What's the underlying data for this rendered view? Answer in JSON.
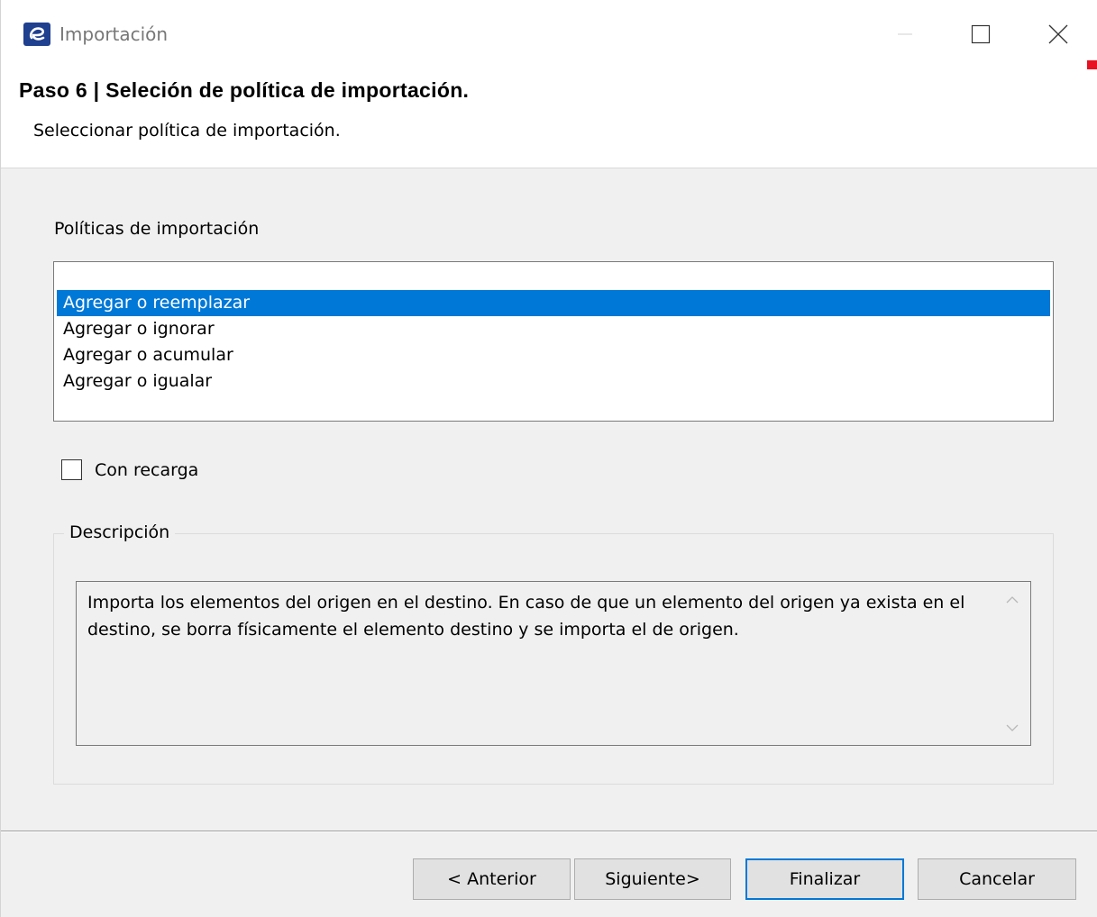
{
  "window": {
    "title": "Importación",
    "icon": "app-logo-icon"
  },
  "header": {
    "step_title": "Paso 6 | Seleción de política de importación.",
    "subtitle": "Seleccionar política de importación."
  },
  "policies": {
    "label": "Políticas de importación",
    "items": [
      {
        "label": "Agregar o reemplazar",
        "selected": true
      },
      {
        "label": "Agregar o ignorar",
        "selected": false
      },
      {
        "label": "Agregar o acumular",
        "selected": false
      },
      {
        "label": "Agregar o igualar",
        "selected": false
      }
    ]
  },
  "reload": {
    "label": "Con recarga",
    "checked": false
  },
  "description": {
    "group_title": "Descripción",
    "text": "Importa los elementos del origen en el destino. En caso de que un elemento del origen ya exista en el destino, se borra físicamente el elemento destino y se importa el de origen."
  },
  "buttons": {
    "previous": "< Anterior",
    "next": "Siguiente>",
    "finish": "Finalizar",
    "cancel": "Cancelar"
  },
  "colors": {
    "selection": "#0078d7",
    "default_button_border": "#0078d7",
    "marker": "#e81123"
  }
}
